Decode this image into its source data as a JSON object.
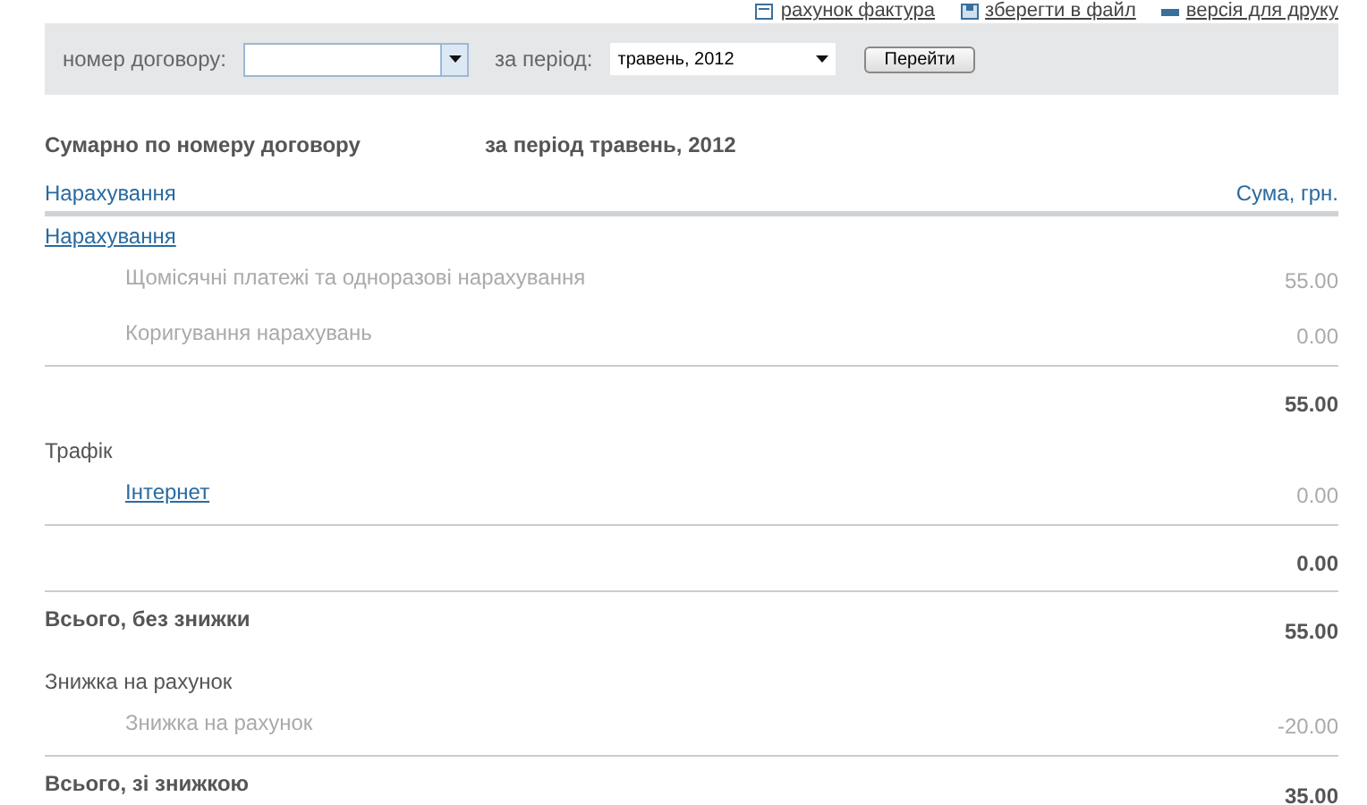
{
  "top_links": [
    {
      "label": "рахунок фактура"
    },
    {
      "label": "зберегти в файл"
    },
    {
      "label": "версія для друку"
    }
  ],
  "filter": {
    "contract_label": "номер договору:",
    "period_label": "за період:",
    "period_value": "травень, 2012",
    "submit": "Перейти"
  },
  "summary": {
    "title": "Сумарно по номеру договору",
    "period": "за період травень, 2012"
  },
  "table": {
    "columns": [
      "Нарахування",
      "Сума, грн."
    ],
    "rows": [
      {
        "kind": "group",
        "label": "Нарахування",
        "link": true
      },
      {
        "kind": "item",
        "label": "Щомісячні платежі та одноразові нарахування",
        "amount": "55.00",
        "link": false
      },
      {
        "kind": "item",
        "label": "Коригування нарахувань",
        "amount": "0.00",
        "link": false
      },
      {
        "kind": "subtotal",
        "amount": "55.00"
      },
      {
        "kind": "group",
        "label": "Трафік",
        "link": false
      },
      {
        "kind": "item",
        "label": "Інтернет",
        "amount": "0.00",
        "link": true
      },
      {
        "kind": "subtotal",
        "amount": "0.00"
      },
      {
        "kind": "total",
        "label": "Всього, без знижки",
        "amount": "55.00"
      },
      {
        "kind": "group",
        "label": "Знижка на рахунок",
        "link": false
      },
      {
        "kind": "item",
        "label": "Знижка на рахунок",
        "amount": "-20.00",
        "link": false
      },
      {
        "kind": "total",
        "label": "Всього, зі знижкою",
        "amount": "35.00"
      }
    ]
  }
}
